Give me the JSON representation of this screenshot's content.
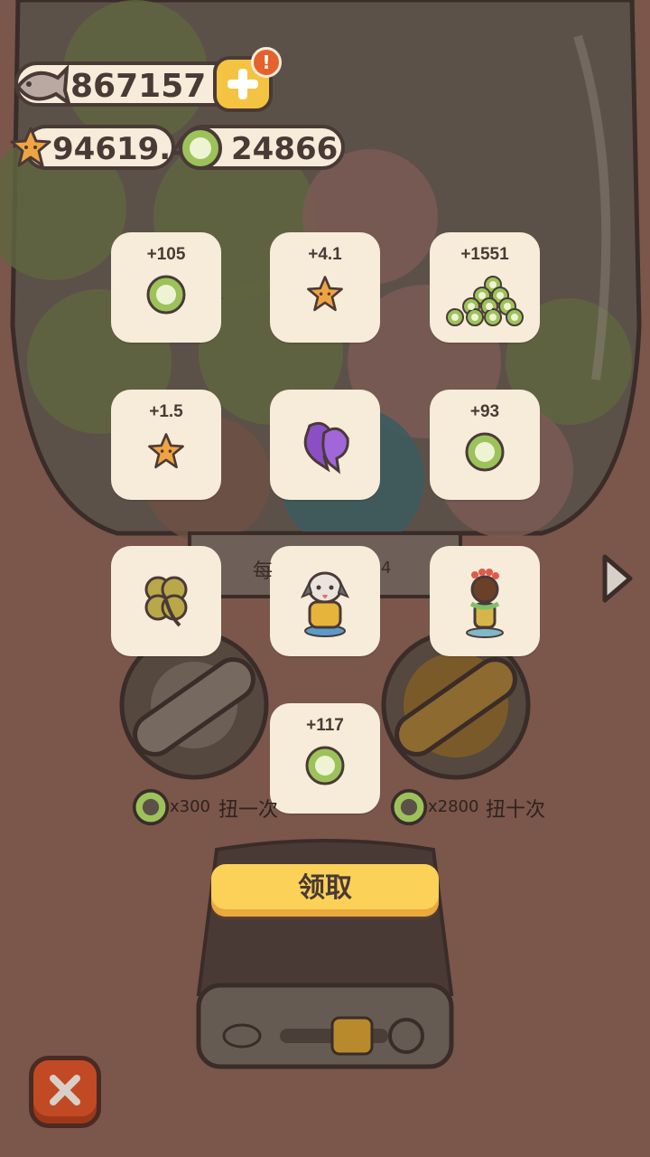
{
  "currencies": {
    "fish": "867157",
    "star": "94619.4",
    "coin": "24866",
    "alert_badge": "!"
  },
  "rewards": [
    {
      "amount": "+105",
      "icon": "coin-icon"
    },
    {
      "amount": "+4.1",
      "icon": "star-icon"
    },
    {
      "amount": "+1551",
      "icon": "coin-pile-icon"
    },
    {
      "amount": "+1.5",
      "icon": "star-icon"
    },
    {
      "amount": "",
      "icon": "purple-fish-icon"
    },
    {
      "amount": "+93",
      "icon": "coin-icon"
    },
    {
      "amount": "",
      "icon": "clover-icon"
    },
    {
      "amount": "",
      "icon": "reading-dog-figure-icon"
    },
    {
      "amount": "",
      "icon": "hula-dog-figure-icon"
    },
    {
      "amount": "+117",
      "icon": "coin-icon"
    }
  ],
  "spin_once": {
    "cost": "x300",
    "label": "扭一次"
  },
  "spin_ten": {
    "cost": "x2800",
    "label": "扭十次"
  },
  "claim_label": "领取",
  "partial_text_left": "每",
  "partial_text_right": "4",
  "colors": {
    "background": "#7a564b",
    "card": "#f6ecd9",
    "claim": "#fbd157",
    "close": "#c14a24"
  }
}
